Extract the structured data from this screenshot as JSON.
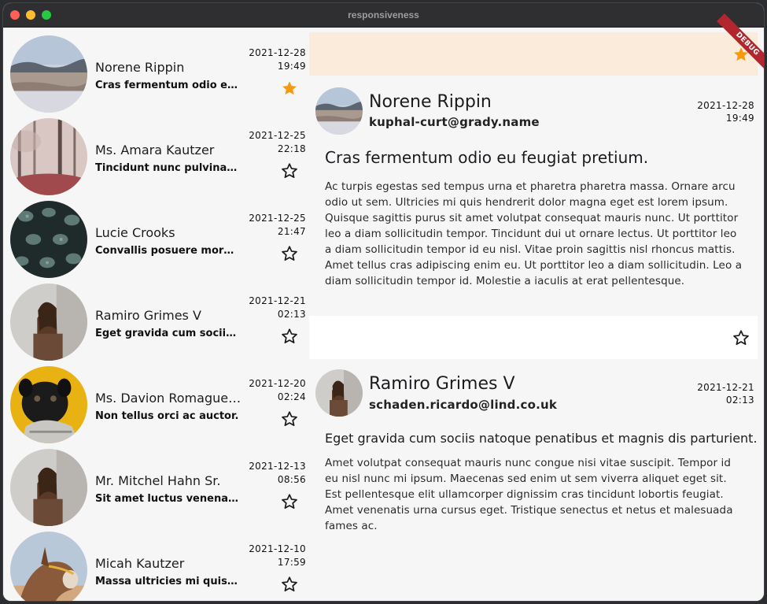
{
  "window": {
    "title": "responsiveness",
    "debug_label": "DEBUG"
  },
  "list": [
    {
      "name": "Norene Rippin",
      "subject": "Cras fermentum odio eu ...",
      "date": "2021-12-28",
      "time": "19:49",
      "starred": true,
      "avatar": "landscape"
    },
    {
      "name": "Ms. Amara Kautzer",
      "subject": "Tincidunt nunc pulvinar ...",
      "date": "2021-12-25",
      "time": "22:18",
      "starred": false,
      "avatar": "forest"
    },
    {
      "name": "Lucie Crooks",
      "subject": "Convallis posuere morbi ...",
      "date": "2021-12-25",
      "time": "21:47",
      "starred": false,
      "avatar": "leaves"
    },
    {
      "name": "Ramiro Grimes V",
      "subject": "Eget gravida cum sociis ...",
      "date": "2021-12-21",
      "time": "02:13",
      "starred": false,
      "avatar": "woman"
    },
    {
      "name": "Ms. Davion Romaguera...",
      "subject": "Non tellus orci ac auctor.",
      "date": "2021-12-20",
      "time": "02:24",
      "starred": false,
      "avatar": "pug"
    },
    {
      "name": "Mr. Mitchel Hahn Sr.",
      "subject": "Sit amet luctus venenatis...",
      "date": "2021-12-13",
      "time": "08:56",
      "starred": false,
      "avatar": "woman"
    },
    {
      "name": "Micah Kautzer",
      "subject": "Massa ultricies mi quis ...",
      "date": "2021-12-10",
      "time": "17:59",
      "starred": false,
      "avatar": "donkey"
    }
  ],
  "detail": {
    "emails": [
      {
        "name": "Norene Rippin",
        "email": "kuphal-curt@grady.name",
        "date": "2021-12-28",
        "time": "19:49",
        "subject": "Cras fermentum odio eu feugiat pretium.",
        "body": "Ac turpis egestas sed tempus urna et pharetra pharetra massa. Ornare arcu odio ut sem. Ultricies mi quis hendrerit dolor magna eget est lorem ipsum. Quisque sagittis purus sit amet volutpat consequat mauris nunc. Ut porttitor leo a diam sollicitudin tempor. Tincidunt dui ut ornare lectus. Ut porttitor leo a diam sollicitudin tempor id eu nisl. Vitae proin sagittis nisl rhoncus mattis. Amet tellus cras adipiscing enim eu. Ut porttitor leo a diam sollicitudin. Leo a diam sollicitudin tempor id. Molestie a iaculis at erat pellentesque.",
        "starred": true
      },
      {
        "name": "Ramiro Grimes V",
        "email": "schaden.ricardo@lind.co.uk",
        "date": "2021-12-21",
        "time": "02:13",
        "subject": "Eget gravida cum sociis natoque penatibus et magnis dis parturient.",
        "body": "Amet volutpat consequat mauris nunc congue nisi vitae suscipit. Tempor id eu nisl nunc mi ipsum. Maecenas sed enim ut sem viverra aliquet eget sit. Est pellentesque elit ullamcorper dignissim cras tincidunt lobortis feugiat. Amet venenatis urna cursus eget. Tristique senectus et netus et malesuada fames ac.",
        "starred": false
      }
    ]
  },
  "colors": {
    "star_filled": "#f59a0f",
    "banner": "#fbebdb",
    "debug": "#b3262d"
  }
}
